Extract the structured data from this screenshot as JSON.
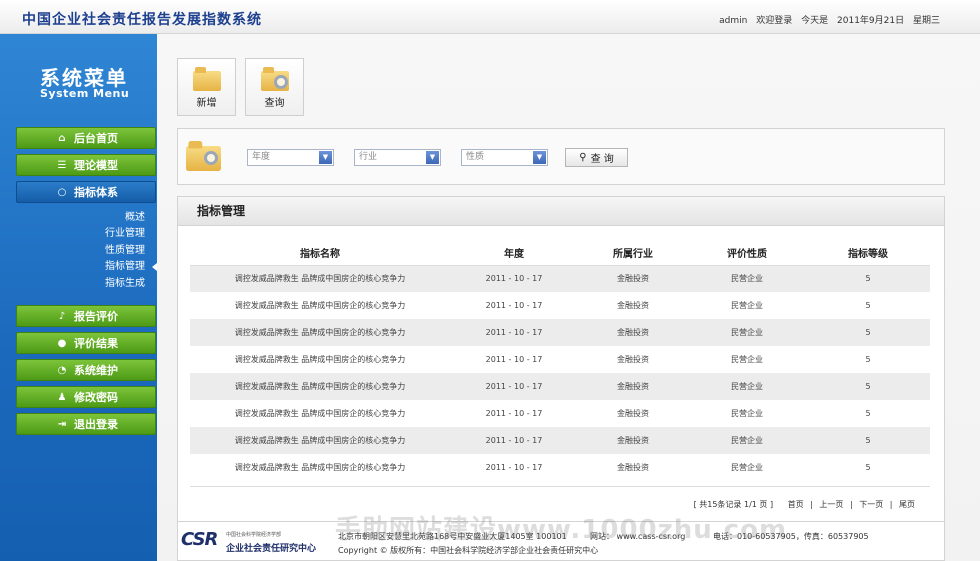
{
  "app": {
    "title": "中国企业社会责任报告发展指数系统"
  },
  "user": {
    "name": "admin",
    "welcome": "欢迎登录",
    "today_label": "今天是",
    "date": "2011年9月21日",
    "weekday": "星期三"
  },
  "sidebar": {
    "title": "系统菜单",
    "subtitle": "System Menu",
    "items": [
      {
        "label": "后台首页",
        "icon": "home-icon"
      },
      {
        "label": "理论模型",
        "icon": "layers-icon"
      },
      {
        "label": "指标体系",
        "icon": "circle-icon",
        "active": true
      },
      {
        "label": "报告评价",
        "icon": "microphone-icon"
      },
      {
        "label": "评价结果",
        "icon": "chat-icon"
      },
      {
        "label": "系统维护",
        "icon": "pie-icon"
      },
      {
        "label": "修改密码",
        "icon": "user-icon"
      },
      {
        "label": "退出登录",
        "icon": "logout-icon"
      }
    ],
    "submenu": [
      "概述",
      "行业管理",
      "性质管理",
      "指标管理",
      "指标生成"
    ]
  },
  "toolbar": {
    "add_label": "新增",
    "query_label": "查询"
  },
  "search": {
    "year_placeholder": "年度",
    "industry_placeholder": "行业",
    "nature_placeholder": "性质",
    "query_button": "查  询"
  },
  "list": {
    "title": "指标管理",
    "columns": [
      "指标名称",
      "年度",
      "所属行业",
      "评价性质",
      "指标等级"
    ],
    "rows": [
      [
        "调控发威品牌救生  品牌成中国房企的核心竞争力",
        "2011 - 10 - 17",
        "金融投资",
        "民营企业",
        "5"
      ],
      [
        "调控发威品牌救生  品牌成中国房企的核心竞争力",
        "2011 - 10 - 17",
        "金融投资",
        "民营企业",
        "5"
      ],
      [
        "调控发威品牌救生  品牌成中国房企的核心竞争力",
        "2011 - 10 - 17",
        "金融投资",
        "民营企业",
        "5"
      ],
      [
        "调控发威品牌救生  品牌成中国房企的核心竞争力",
        "2011 - 10 - 17",
        "金融投资",
        "民营企业",
        "5"
      ],
      [
        "调控发威品牌救生  品牌成中国房企的核心竞争力",
        "2011 - 10 - 17",
        "金融投资",
        "民营企业",
        "5"
      ],
      [
        "调控发威品牌救生  品牌成中国房企的核心竞争力",
        "2011 - 10 - 17",
        "金融投资",
        "民营企业",
        "5"
      ],
      [
        "调控发威品牌救生  品牌成中国房企的核心竞争力",
        "2011 - 10 - 17",
        "金融投资",
        "民营企业",
        "5"
      ],
      [
        "调控发威品牌救生  品牌成中国房企的核心竞争力",
        "2011 - 10 - 17",
        "金融投资",
        "民营企业",
        "5"
      ]
    ],
    "pager": {
      "summary": "[ 共15条记录  1/1 页 ]",
      "first": "首页",
      "prev": "上一页",
      "next": "下一页",
      "last": "尾页",
      "sep": "|"
    }
  },
  "footer": {
    "logo_text": "CSR",
    "logo_small": "中国社会科学院经济学部",
    "org_name": "企业社会责任研究中心",
    "address": "北京市朝阳区安慧里北苑路168号中安盛业大厦1405室  100101",
    "website_label": "网站：",
    "website": "www.cass-csr.org",
    "phone": "电话：010-60537905，传真：60537905",
    "copyright": "Copyright © 版权所有：中国社会科学院经济学部企业社会责任研究中心"
  },
  "watermark": "手助网站建设www.1000zhu.com",
  "colors": {
    "sidebar_blue": "#1b69bd",
    "menu_green": "#5aa81e",
    "title_blue": "#1d3f8f"
  }
}
